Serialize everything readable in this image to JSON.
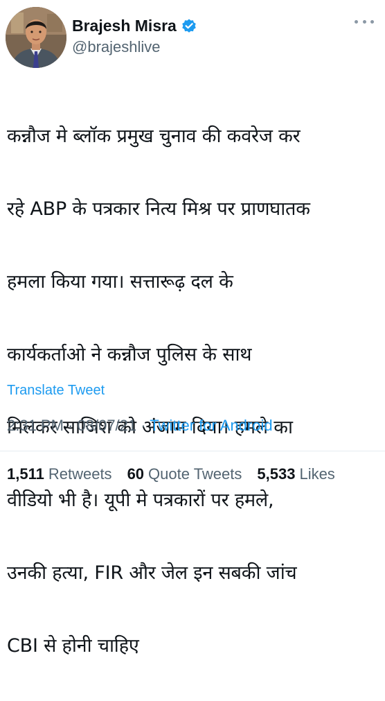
{
  "tweet": {
    "author": {
      "display_name": "Brajesh Misra",
      "handle": "@brajeshlive",
      "verified": true
    },
    "text_lines": [
      "कन्नौज मे ब्लॉक प्रमुख चुनाव की कवरेज कर",
      "रहे ABP के पत्रकार नित्य मिश्र पर प्राणघातक",
      "हमला किया गया। सत्तारूढ़ दल के",
      "कार्यकर्ताओ ने कन्नौज पुलिस के साथ",
      "मिलकर साजिश को अंजाम दिया। हमले का",
      "वीडियो भी है। यूपी मे पत्रकारों पर हमले,",
      "उनकी हत्या, FIR और जेल इन सबकी जांच",
      "CBI से होनी चाहिए"
    ],
    "translate_label": "Translate Tweet",
    "time": "2:31 PM",
    "date": "08/07/21",
    "separator": " · ",
    "source": "Twitter for Android",
    "stats": {
      "retweets_count": "1,511",
      "retweets_label": "Retweets",
      "quotes_count": "60",
      "quotes_label": "Quote Tweets",
      "likes_count": "5,533",
      "likes_label": "Likes"
    }
  },
  "colors": {
    "text": "#0f1419",
    "secondary": "#536471",
    "link": "#1d9bf0",
    "verified": "#1d9bf0"
  },
  "icons": {
    "verified": "verified-badge-icon",
    "more": "more-dots-icon"
  }
}
